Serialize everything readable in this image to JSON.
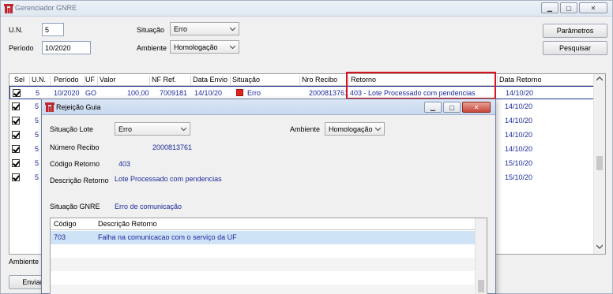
{
  "window": {
    "title": "Gerenciador GNRE"
  },
  "filters": {
    "un_label": "U.N.",
    "un_value": "5",
    "periodo_label": "Período",
    "periodo_value": "10/2020",
    "situacao_label": "Situação",
    "situacao_value": "Erro",
    "ambiente_label": "Ambiente",
    "ambiente_value": "Homologação"
  },
  "buttons": {
    "parametros": "Parâmetros",
    "pesquisar": "Pesquisar",
    "enviar": "Enviar"
  },
  "bottom": {
    "ambiente_label": "Ambiente"
  },
  "grid": {
    "columns": [
      "Sel",
      "U.N.",
      "Período",
      "UF",
      "Valor",
      "NF Ref.",
      "Data Envio",
      "Situação",
      "Nro Recibo",
      "Retorno",
      "Data Retorno"
    ],
    "rows": [
      {
        "un": "5",
        "periodo": "10/2020",
        "uf": "GO",
        "valor": "100,00",
        "nf": "7009181",
        "data_envio": "14/10/20",
        "situacao": "Erro",
        "recibo": "2000813761",
        "retorno": "403 - Lote Processado com pendencias",
        "data_retorno": "14/10/20"
      },
      {
        "un": "5",
        "data_retorno": "14/10/20"
      },
      {
        "un": "5",
        "data_retorno": "14/10/20"
      },
      {
        "un": "5",
        "data_retorno": "14/10/20"
      },
      {
        "un": "5",
        "data_retorno": "14/10/20"
      },
      {
        "un": "5",
        "data_retorno": "15/10/20"
      },
      {
        "un": "5",
        "data_retorno": "15/10/20"
      }
    ],
    "status_color": "#e2231a"
  },
  "dialog": {
    "title": "Rejeição Guia",
    "situacao_lote_label": "Situação Lote",
    "situacao_lote_value": "Erro",
    "ambiente_label": "Ambiente",
    "ambiente_value": "Homologação",
    "numero_recibo_label": "Número Recibo",
    "numero_recibo_value": "2000813761",
    "codigo_retorno_label": "Código Retorno",
    "codigo_retorno_value": "403",
    "descricao_retorno_label": "Descrição Retorno",
    "descricao_retorno_value": "Lote Processado com pendencias",
    "situacao_gnre_label": "Situação GNRE",
    "situacao_gnre_value": "Erro de comunicação",
    "subgrid": {
      "columns": [
        "Código",
        "Descrição Retorno"
      ],
      "rows": [
        {
          "codigo": "703",
          "descricao": "Falha na comunicacao com o serviço da UF"
        }
      ]
    }
  }
}
